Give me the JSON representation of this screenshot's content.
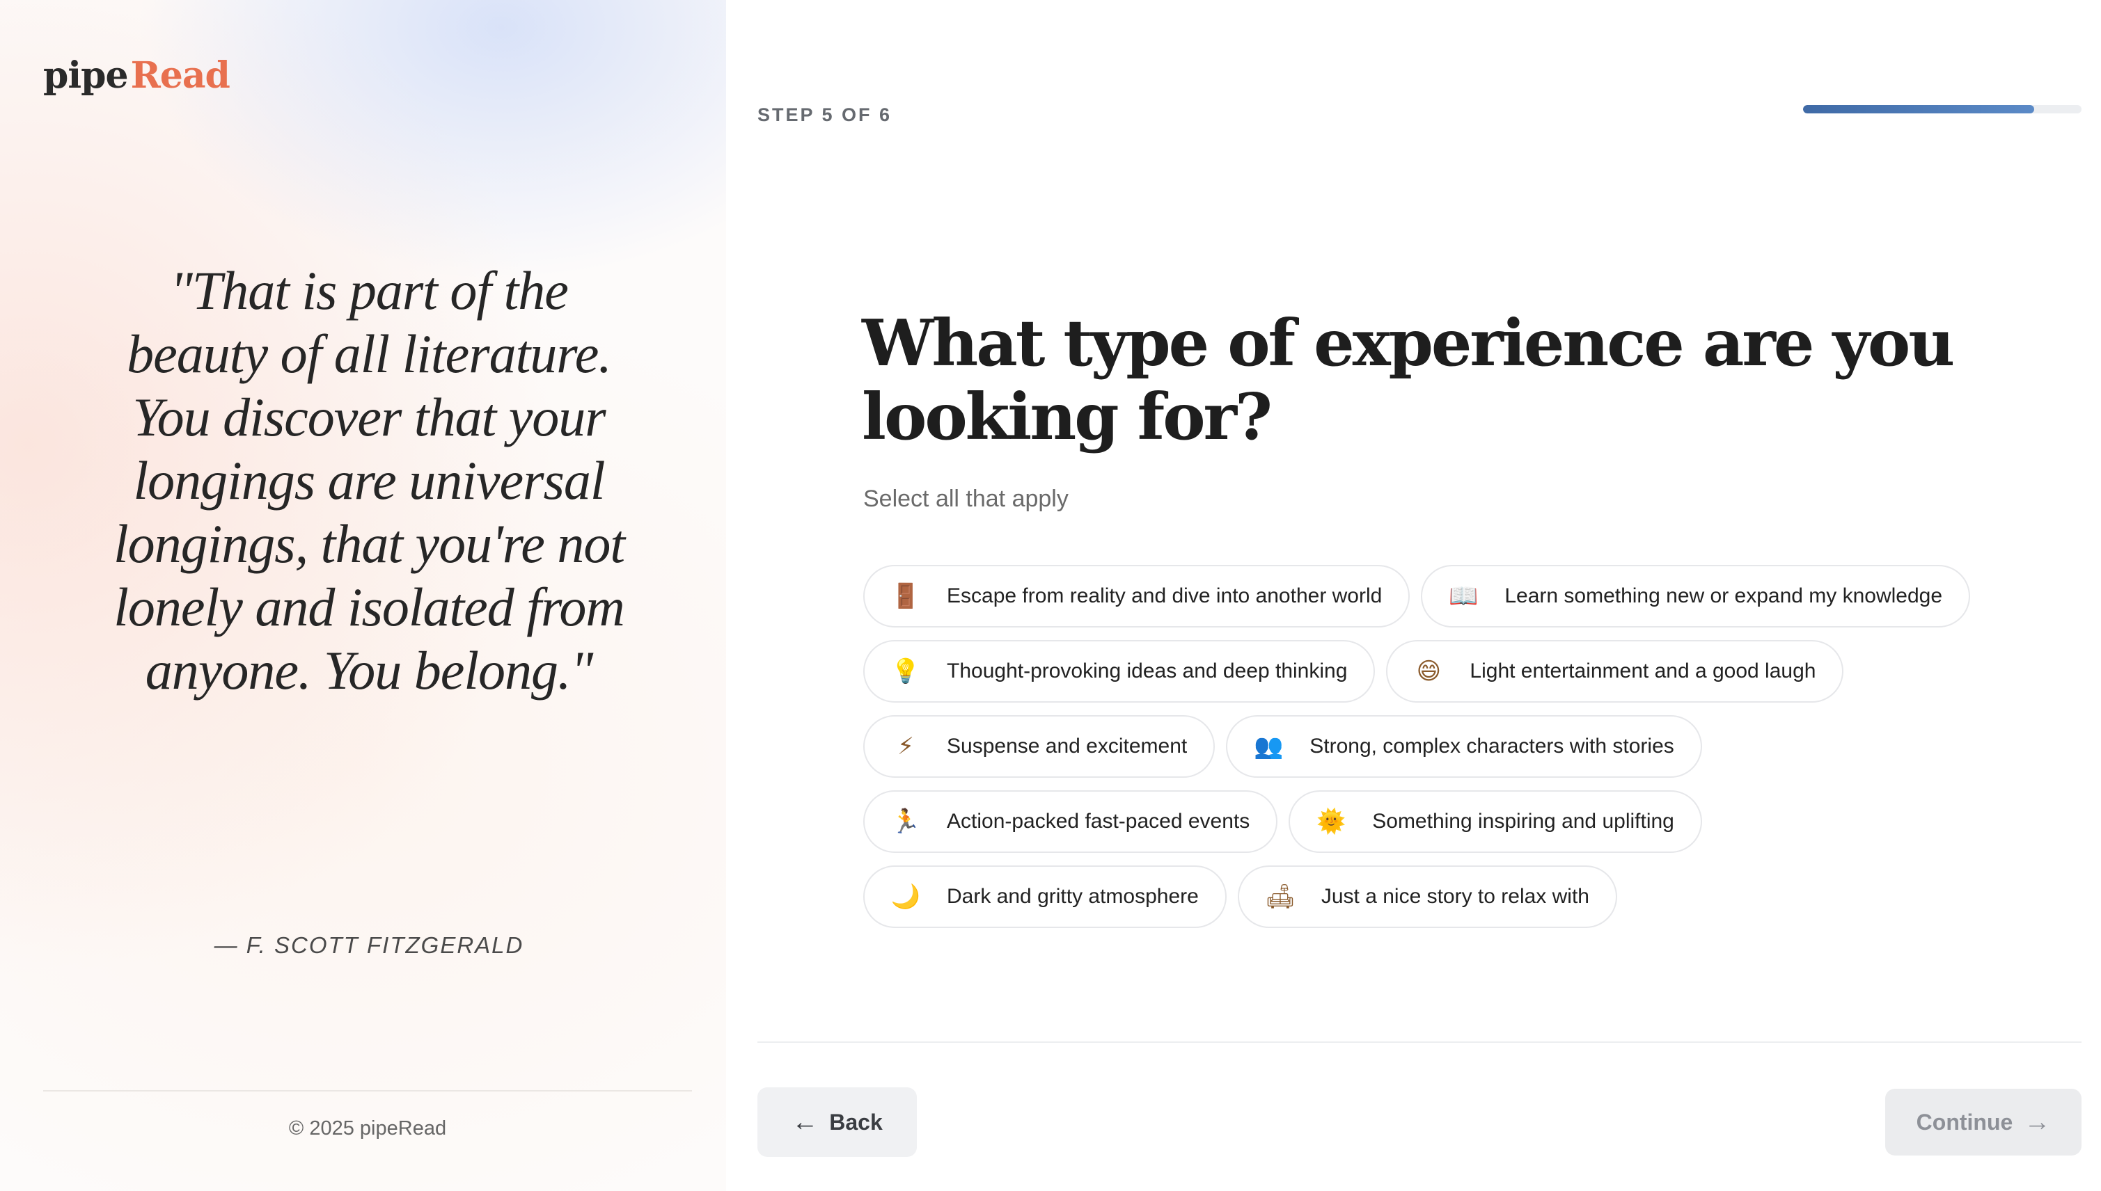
{
  "brand": {
    "part1": "pipe",
    "part2": "Read",
    "accent_color": "#e8704f"
  },
  "quote": {
    "text": "\"That is part of the beauty of all literature. You discover that your longings are universal longings, that you're not lonely and isolated from anyone. You belong.\"",
    "author": "— F. SCOTT FITZGERALD"
  },
  "footer": {
    "copyright": "© 2025 pipeRead"
  },
  "progress": {
    "label": "STEP 5 OF 6",
    "current_step": 5,
    "total_steps": 6,
    "fill_percent": 83
  },
  "question": {
    "title": "What type of experience are you looking for?",
    "subtitle": "Select all that apply"
  },
  "options": [
    {
      "icon_name": "door-icon",
      "glyph": "🚪",
      "label": "Escape from reality and dive into another world",
      "selected": false
    },
    {
      "icon_name": "open-book-icon",
      "glyph": "📖",
      "label": "Learn something new or expand my knowledge",
      "selected": false
    },
    {
      "icon_name": "lightbulb-icon",
      "glyph": "💡",
      "label": "Thought-provoking ideas and deep thinking",
      "selected": false
    },
    {
      "icon_name": "grinning-face-icon",
      "glyph": "😄",
      "label": "Light entertainment and a good laugh",
      "selected": false
    },
    {
      "icon_name": "lightning-icon",
      "glyph": "⚡",
      "label": "Suspense and excitement",
      "selected": false
    },
    {
      "icon_name": "people-icon",
      "glyph": "👥",
      "label": "Strong, complex characters with stories",
      "selected": false
    },
    {
      "icon_name": "running-person-icon",
      "glyph": "🏃",
      "label": "Action-packed fast-paced events",
      "selected": false
    },
    {
      "icon_name": "sun-icon",
      "glyph": "🌞",
      "label": "Something inspiring and uplifting",
      "selected": false
    },
    {
      "icon_name": "crescent-moon-icon",
      "glyph": "🌙",
      "label": "Dark and gritty atmosphere",
      "selected": false
    },
    {
      "icon_name": "couch-icon",
      "glyph": "🛋",
      "label": "Just a nice story to relax with",
      "selected": false
    }
  ],
  "navigation": {
    "back_label": "Back",
    "back_icon": "arrow-left-icon",
    "continue_label": "Continue",
    "continue_icon": "arrow-right-icon",
    "continue_enabled": false
  }
}
